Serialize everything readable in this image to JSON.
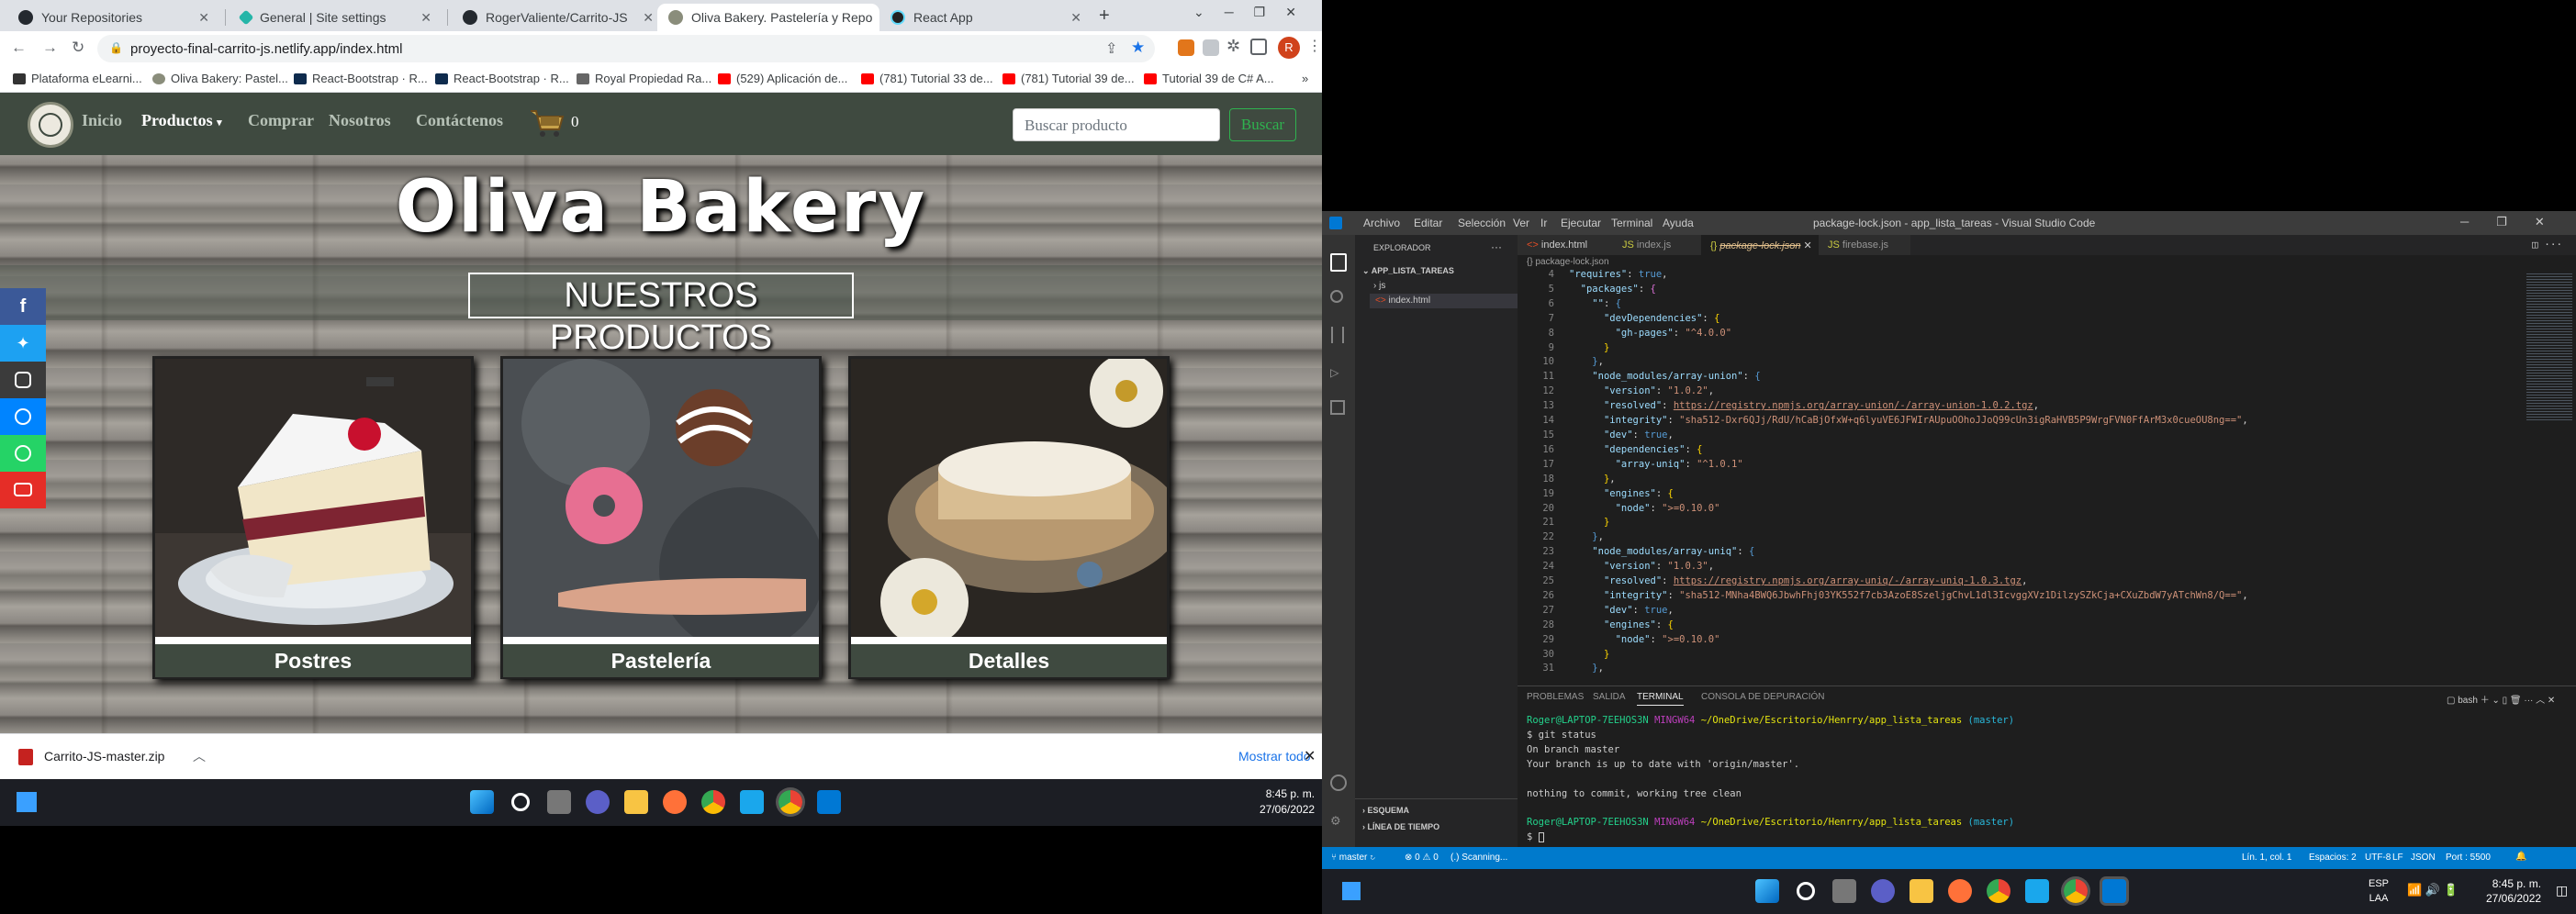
{
  "left_screen": {
    "tabs": [
      {
        "title": "Your Repositories"
      },
      {
        "title": "General | Site settings"
      },
      {
        "title": "RogerValiente/Carrito-JS"
      },
      {
        "title": "Oliva Bakery. Pastelería y Repo"
      },
      {
        "title": "React App"
      }
    ],
    "url": "proyecto-final-carrito-js.netlify.app/index.html",
    "bookmarks": [
      "Plataforma eLearni...",
      "Oliva Bakery: Pastel...",
      "React-Bootstrap · R...",
      "React-Bootstrap · R...",
      "Royal Propiedad Ra...",
      "(529) Aplicación de...",
      "(781) Tutorial 33 de...",
      "(781) Tutorial 39 de...",
      "Tutorial 39 de C# A..."
    ],
    "site": {
      "nav": {
        "inicio": "Inicio",
        "productos": "Productos",
        "comprar": "Comprar",
        "nosotros": "Nosotros",
        "contactenos": "Contáctenos",
        "cart_count": "0"
      },
      "search": {
        "placeholder": "Buscar producto",
        "button": "Buscar"
      },
      "brand_title": "Oliva Bakery",
      "section_title": "NUESTROS PRODUCTOS",
      "cards": [
        {
          "caption": "Postres"
        },
        {
          "caption": "Pastelería"
        },
        {
          "caption": "Detalles"
        }
      ]
    },
    "download": {
      "file": "Carrito-JS-master.zip",
      "show_all": "Mostrar todo"
    },
    "clock": {
      "time": "8:45 p. m.",
      "date": "27/06/2022"
    }
  },
  "right_screen": {
    "menu": [
      "Archivo",
      "Editar",
      "Selección",
      "Ver",
      "Ir",
      "Ejecutar",
      "Terminal",
      "Ayuda"
    ],
    "window_title": "package-lock.json - app_lista_tareas - Visual Studio Code",
    "explorer": {
      "header": "EXPLORADOR",
      "project": "APP_LISTA_TAREAS",
      "items": [
        "js",
        "index.html"
      ],
      "outline": "ESQUEMA",
      "timeline": "LÍNEA DE TIEMPO"
    },
    "editor_tabs": [
      "index.html",
      "index.js",
      "package-lock.json",
      "firebase.js"
    ],
    "breadcrumb": "{} package-lock.json",
    "code": {
      "line_numbers": [
        "4",
        "5",
        "6",
        "7",
        "8",
        "9",
        "10",
        "11",
        "12",
        "13",
        "14",
        "15",
        "16",
        "17",
        "18",
        "19",
        "20",
        "21",
        "22",
        "23",
        "24",
        "25",
        "26",
        "27",
        "28",
        "29",
        "30",
        "31"
      ],
      "resolved_union": "https://registry.npmjs.org/array-union/-/array-union-1.0.2.tgz",
      "integrity_union": "sha512-Dxr6QJj/RdU/hCaBjOfxW+q6lyuVE6JFWIrAUpuOOhoJJoQ99cUn3igRaHVB5P9WrgFVN0FfArM3x0cueOU8ng==",
      "resolved_uniq": "https://registry.npmjs.org/array-uniq/-/array-uniq-1.0.3.tgz",
      "integrity_uniq": "sha512-MNha4BWQ6JbwhFhj03YK552f7cb3AzoE8SzeljgChvL1dl3IcvggXVz1DilzySZkCja+CXuZbdW7yATchWn8/Q=="
    },
    "panel": {
      "tabs": [
        "PROBLEMAS",
        "SALIDA",
        "TERMINAL",
        "CONSOLA DE DEPURACIÓN"
      ],
      "shell": "bash",
      "prompt_user": "Roger@LAPTOP-7EEHOS3N",
      "prompt_env": "MINGW64",
      "prompt_path": "~/OneDrive/Escritorio/Henrry/app_lista_tareas",
      "prompt_branch": "(master)",
      "cmd": "$ git status",
      "out1": "On branch master",
      "out2": "Your branch is up to date with 'origin/master'.",
      "out3": "nothing to commit, working tree clean",
      "cursor": "$ "
    },
    "status": {
      "branch": "master",
      "problems": "⊗ 0 ⚠ 0",
      "scanning": "(.) Scanning...",
      "position": "Lín. 1, col. 1",
      "spaces": "Espacios: 2",
      "encoding": "UTF-8",
      "eol": "LF",
      "language": "JSON",
      "port": "Port : 5500"
    },
    "clock": {
      "lang": "ESP",
      "layout": "LAA",
      "time": "8:45 p. m.",
      "date": "27/06/2022"
    }
  }
}
